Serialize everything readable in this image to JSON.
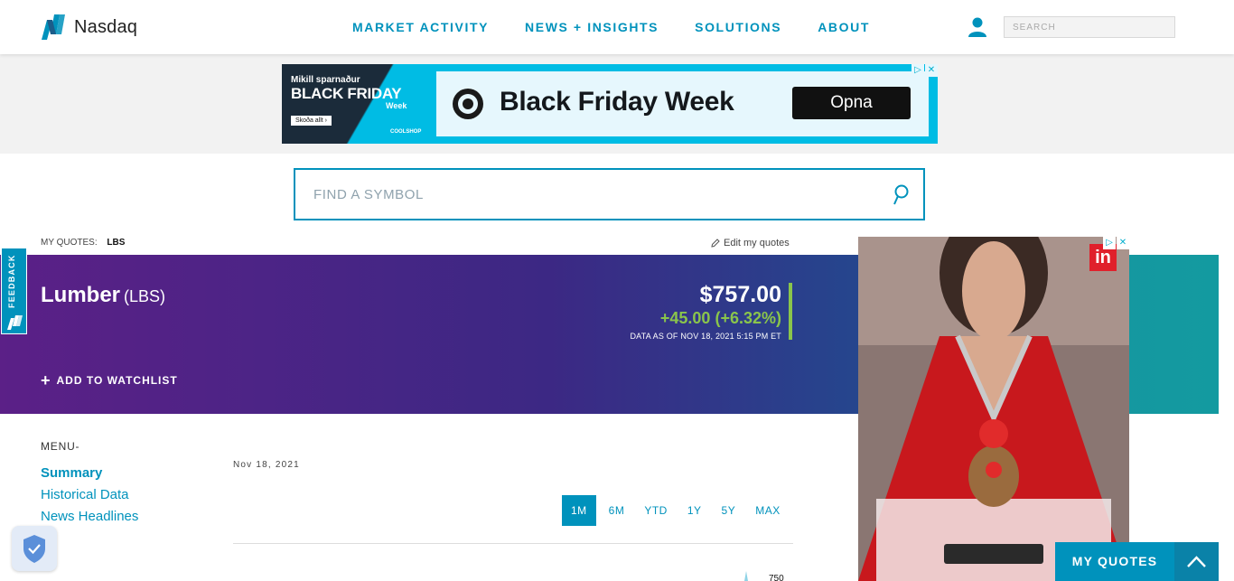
{
  "header": {
    "logo_text": "Nasdaq",
    "nav": [
      "MARKET ACTIVITY",
      "NEWS + INSIGHTS",
      "SOLUTIONS",
      "ABOUT"
    ],
    "search_placeholder": "SEARCH"
  },
  "ad_top": {
    "small": "Mikill sparnaður",
    "big": "BLACK FRIDAY",
    "week": "Week",
    "cta_small": "Skoða allt ›",
    "brand": "COOLSHOP",
    "title": "Black Friday Week",
    "button": "Opna"
  },
  "symbol_search": {
    "placeholder": "FIND A SYMBOL"
  },
  "my_quotes": {
    "label": "MY QUOTES:",
    "symbol": "LBS",
    "edit": "Edit my quotes"
  },
  "quote": {
    "name": "Lumber",
    "ticker": "(LBS)",
    "price": "$757.00",
    "change": "+45.00 (+6.32%)",
    "as_of": "DATA AS OF NOV 18, 2021 5:15 PM ET",
    "watchlist": "ADD TO WATCHLIST"
  },
  "feedback": {
    "label": "FEEDBACK"
  },
  "menu": {
    "label": "MENU-",
    "items": [
      "Summary",
      "Historical Data",
      "News Headlines"
    ]
  },
  "chart": {
    "date": "Nov 18, 2021",
    "ranges": [
      "1M",
      "6M",
      "YTD",
      "1Y",
      "5Y",
      "MAX"
    ],
    "active_range": "1M",
    "axis_tick": "750"
  },
  "side_ad": {
    "brand": "in"
  },
  "bottom": {
    "my_quotes_tab": "MY QUOTES"
  },
  "colors": {
    "accent": "#0092bc",
    "positive": "#8ac54b",
    "hero_start": "#5b2087",
    "hero_end": "#139aa0"
  }
}
